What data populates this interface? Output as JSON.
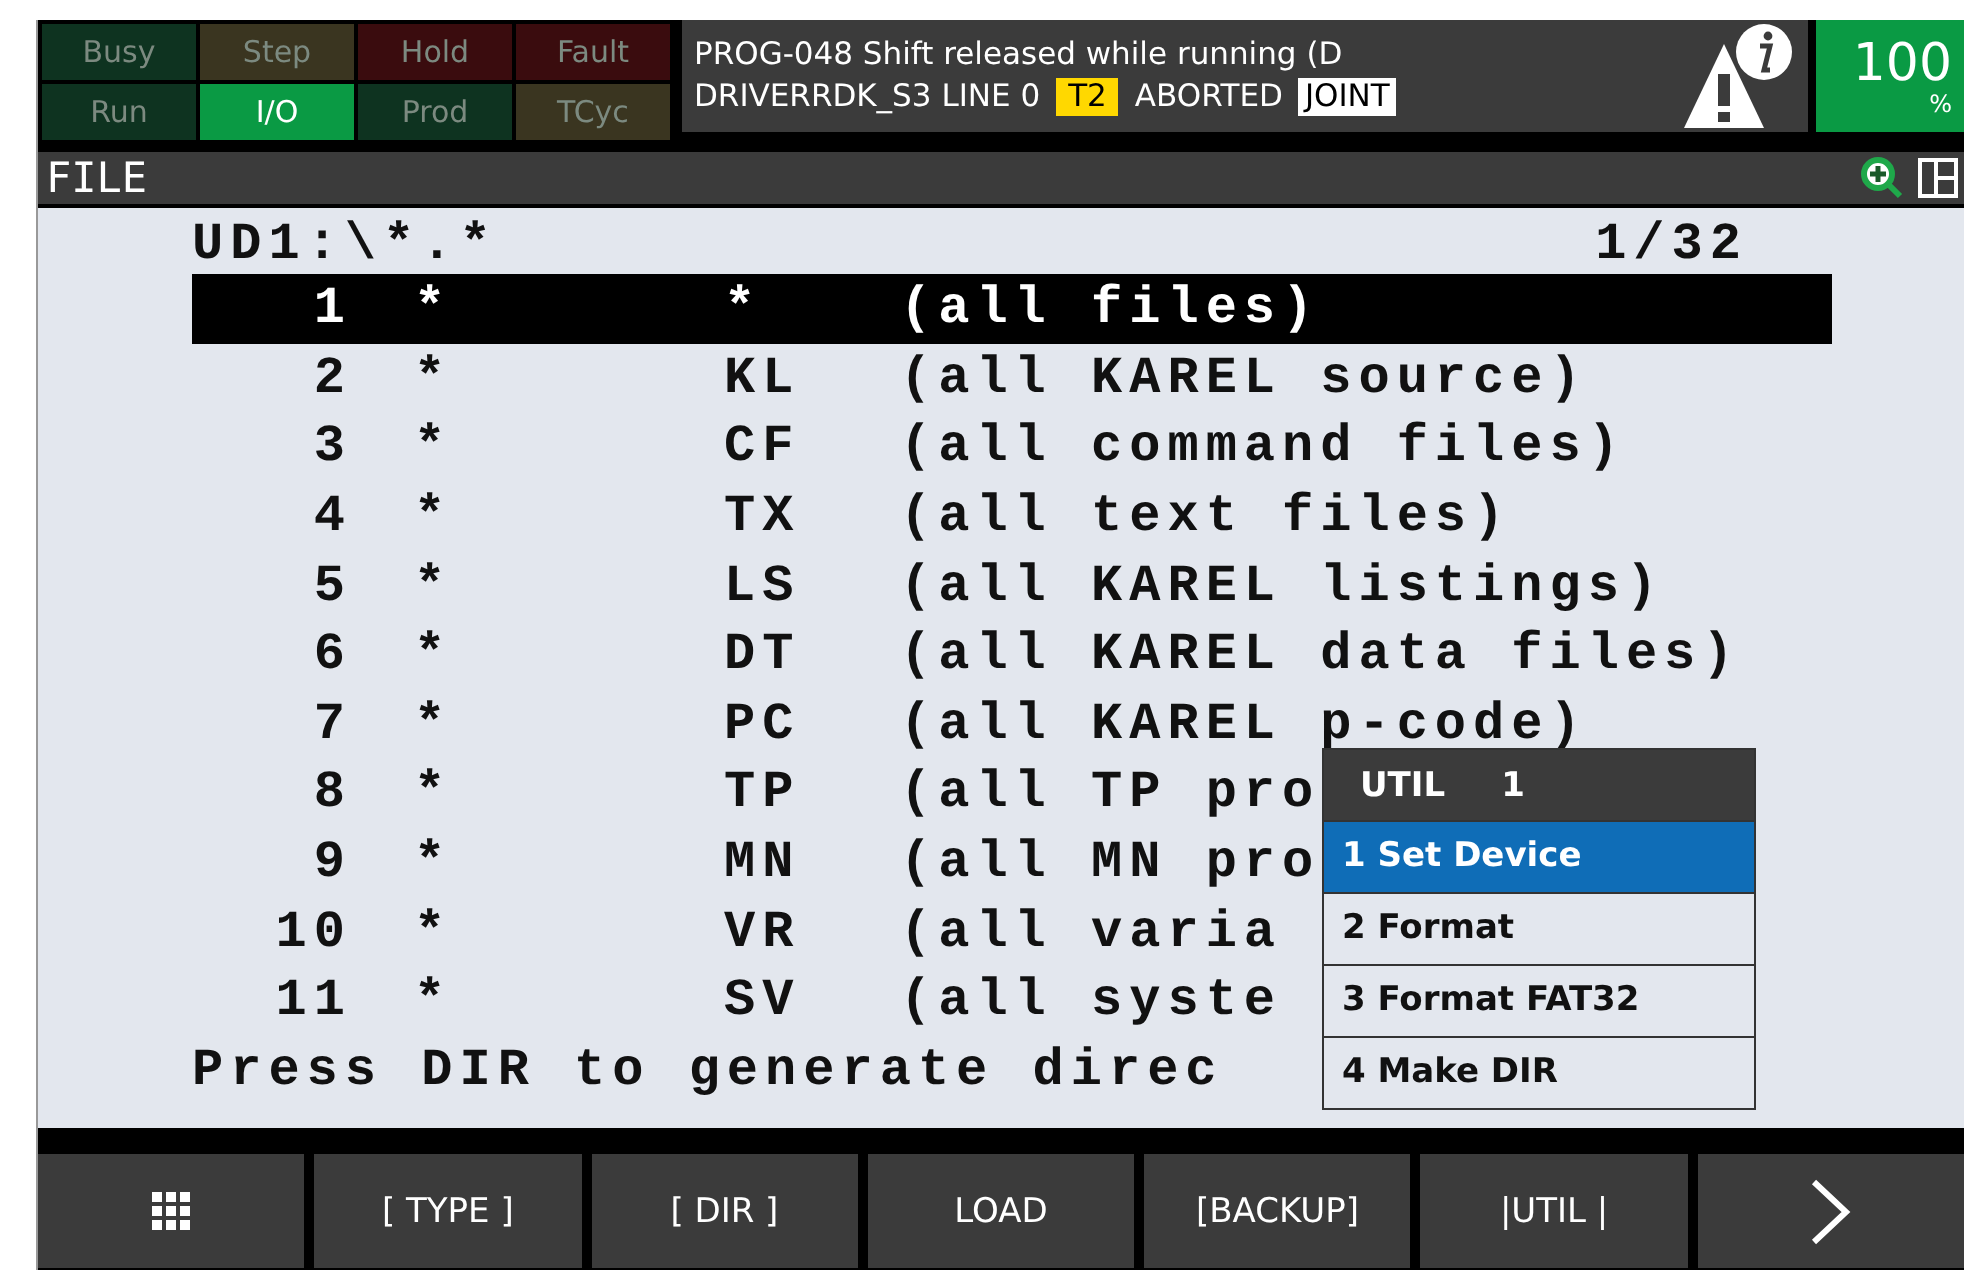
{
  "status_lamps": [
    {
      "label": "Busy",
      "color": "#0e3320",
      "on": false
    },
    {
      "label": "Step",
      "color": "#3a3520",
      "on": false
    },
    {
      "label": "Hold",
      "color": "#3a0c0e",
      "on": false
    },
    {
      "label": "Fault",
      "color": "#3a0c0e",
      "on": false
    },
    {
      "label": "Run",
      "color": "#0e3320",
      "on": false
    },
    {
      "label": "I/O",
      "color": "#0a9a44",
      "on": true
    },
    {
      "label": "Prod",
      "color": "#0e3320",
      "on": false
    },
    {
      "label": "TCyc",
      "color": "#3a3520",
      "on": false
    }
  ],
  "message": {
    "line_1": "PROG-048 Shift released while running (D",
    "program": "DRIVERRDK_S3 LINE 0",
    "mode": "T2",
    "state": "ABORTED",
    "coord": "JOINT"
  },
  "override": {
    "value": "100",
    "unit": "%"
  },
  "screen_title": "FILE",
  "file_list": {
    "path": "UD1:\\*.*",
    "position": "1/32",
    "rows": [
      {
        "number": "1",
        "name": "*",
        "type": "*",
        "description": "(all files)",
        "selected": true
      },
      {
        "number": "2",
        "name": "*",
        "type": "KL",
        "description": "(all KAREL source)",
        "selected": false
      },
      {
        "number": "3",
        "name": "*",
        "type": "CF",
        "description": "(all command files)",
        "selected": false
      },
      {
        "number": "4",
        "name": "*",
        "type": "TX",
        "description": "(all text files)",
        "selected": false
      },
      {
        "number": "5",
        "name": "*",
        "type": "LS",
        "description": "(all KAREL listings)",
        "selected": false
      },
      {
        "number": "6",
        "name": "*",
        "type": "DT",
        "description": "(all KAREL data files)",
        "selected": false
      },
      {
        "number": "7",
        "name": "*",
        "type": "PC",
        "description": "(all KAREL p-code)",
        "selected": false
      },
      {
        "number": "8",
        "name": "*",
        "type": "TP",
        "description": "(all TP pro",
        "selected": false
      },
      {
        "number": "9",
        "name": "*",
        "type": "MN",
        "description": "(all MN pro",
        "selected": false
      },
      {
        "number": "10",
        "name": "*",
        "type": "VR",
        "description": "(all varia",
        "selected": false
      },
      {
        "number": "11",
        "name": "*",
        "type": "SV",
        "description": "(all syste",
        "selected": false
      }
    ],
    "prompt": "Press DIR to generate direc"
  },
  "popup_menu": {
    "title": "UTIL",
    "page": "1",
    "items": [
      {
        "label": "1 Set Device",
        "selected": true
      },
      {
        "label": "2 Format",
        "selected": false
      },
      {
        "label": "3 Format FAT32",
        "selected": false
      },
      {
        "label": "4 Make DIR",
        "selected": false
      }
    ]
  },
  "softkeys": [
    {
      "kind": "menu"
    },
    {
      "kind": "text",
      "label": "[ TYPE ]"
    },
    {
      "kind": "text",
      "label": "[ DIR ]"
    },
    {
      "kind": "text",
      "label": "LOAD"
    },
    {
      "kind": "text",
      "label": "[BACKUP]"
    },
    {
      "kind": "text",
      "label": "|UTIL |"
    },
    {
      "kind": "next"
    }
  ]
}
